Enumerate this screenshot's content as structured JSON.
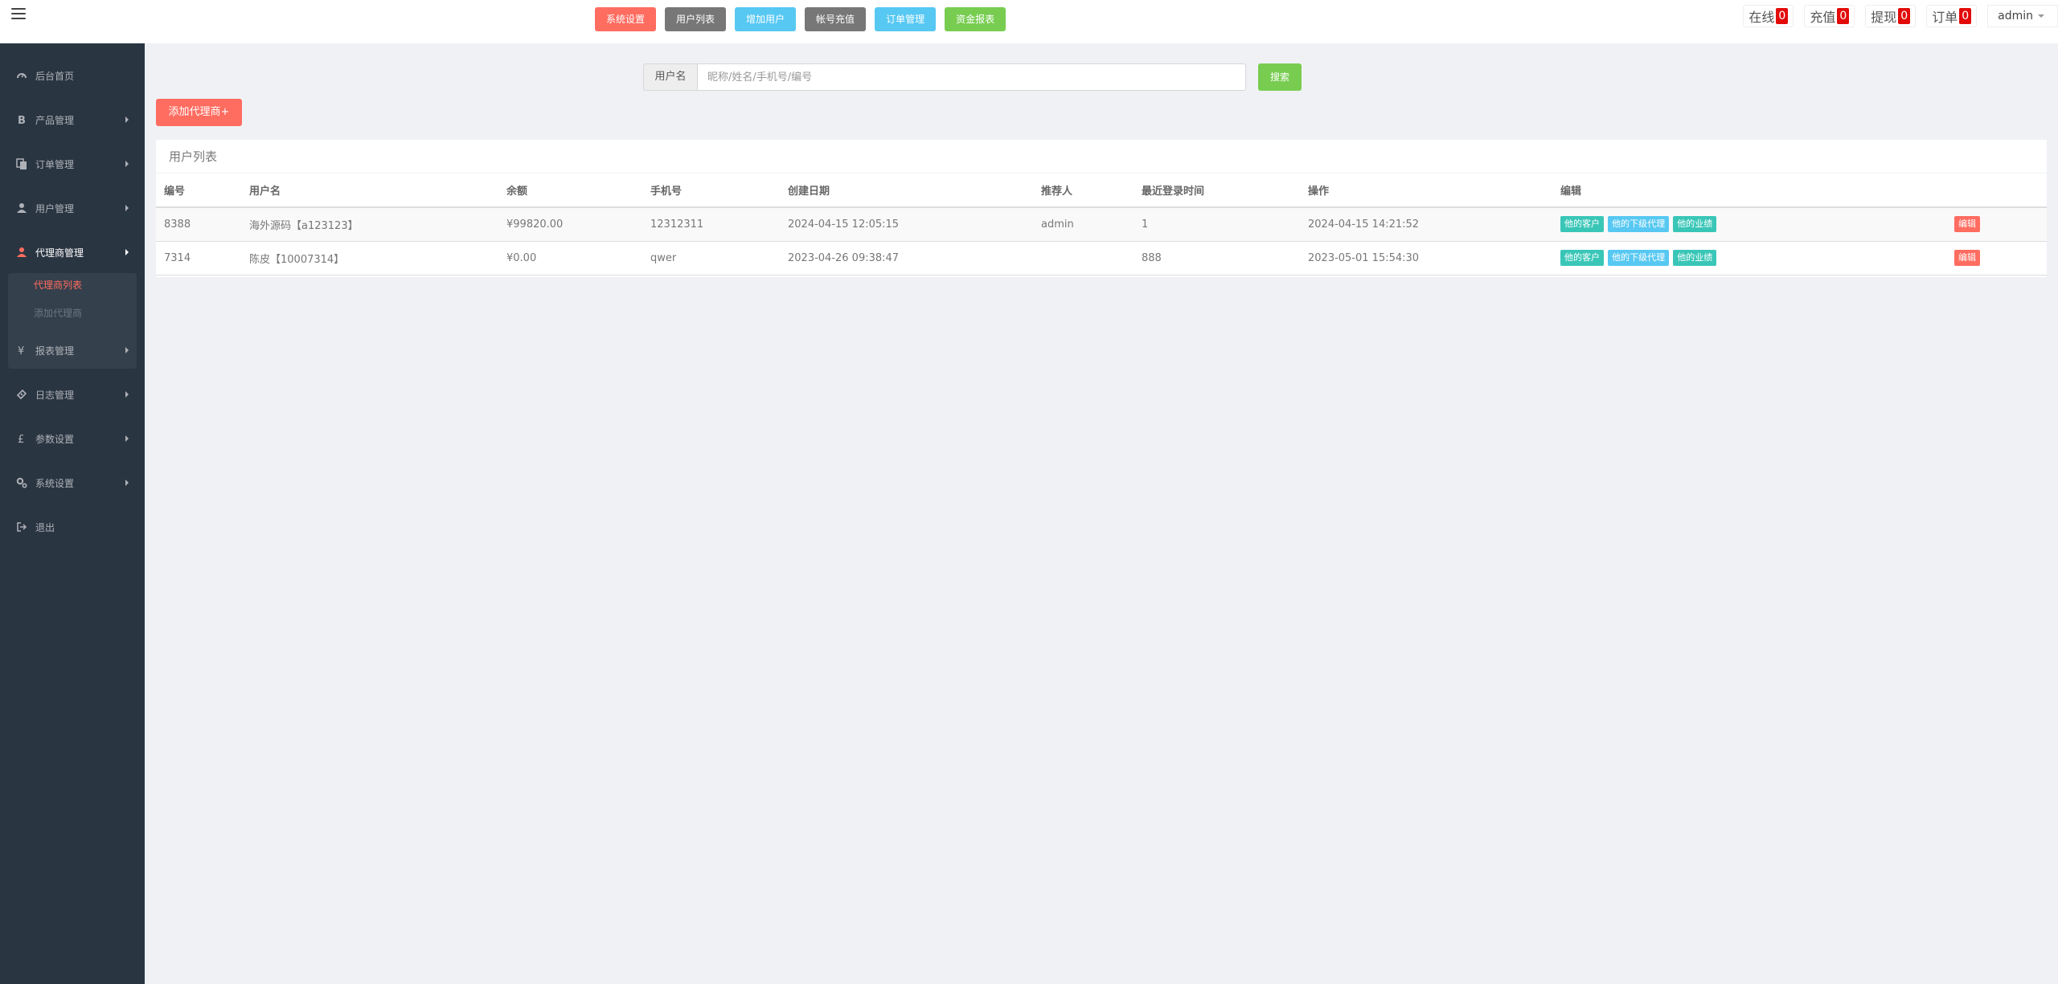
{
  "colors": {
    "sidebar_bg": "#2a3542",
    "accent_red": "#ff6c60",
    "success_green": "#78cd51",
    "info_blue": "#57c8f2",
    "gray": "#777777",
    "badge_red": "#e30a0a"
  },
  "header": {
    "menu_icon": "hamburger-icon",
    "quick_nav": [
      {
        "label": "系统设置",
        "color": "#ff6c60"
      },
      {
        "label": "用户列表",
        "color": "#777777"
      },
      {
        "label": "增加用户",
        "color": "#57c8f2"
      },
      {
        "label": "帐号充值",
        "color": "#777777"
      },
      {
        "label": "订单管理",
        "color": "#57c8f2"
      },
      {
        "label": "资金报表",
        "color": "#78cd51"
      }
    ],
    "stats": [
      {
        "label": "在线",
        "count": "0"
      },
      {
        "label": "充值",
        "count": "0"
      },
      {
        "label": "提现",
        "count": "0"
      },
      {
        "label": "订单",
        "count": "0"
      }
    ],
    "username": "admin"
  },
  "sidebar": {
    "items": [
      {
        "label": "后台首页",
        "icon": "dashboard-icon"
      },
      {
        "label": "产品管理",
        "icon": "bitcoin-icon"
      },
      {
        "label": "订单管理",
        "icon": "copy-icon"
      },
      {
        "label": "用户管理",
        "icon": "user-icon"
      },
      {
        "label": "代理商管理",
        "icon": "sitemap-icon",
        "active": true
      },
      {
        "label": "报表管理",
        "icon": "yen-icon"
      },
      {
        "label": "日志管理",
        "icon": "ticket-icon"
      },
      {
        "label": "参数设置",
        "icon": "pound-icon"
      },
      {
        "label": "系统设置",
        "icon": "cogs-icon"
      },
      {
        "label": "退出",
        "icon": "sign-out-icon"
      }
    ],
    "sub_items": [
      {
        "label": "代理商列表",
        "current": true
      },
      {
        "label": "添加代理商",
        "current": false
      }
    ]
  },
  "search": {
    "addon_label": "用户名",
    "placeholder": "昵称/姓名/手机号/编号",
    "value": "",
    "button_label": "搜索"
  },
  "add_agent_button": "添加代理商+",
  "panel": {
    "title": "用户列表",
    "columns": [
      "编号",
      "用户名",
      "余额",
      "手机号",
      "创建日期",
      "推荐人",
      "最近登录时间",
      "操作",
      "编辑"
    ],
    "rows": [
      {
        "id": "8388",
        "username": "海外源码【a123123】",
        "balance": "¥99820.00",
        "phone": "12312311",
        "created": "2024-04-15 12:05:15",
        "referrer": "admin",
        "recent_login": "1",
        "operation": "2024-04-15 14:21:52"
      },
      {
        "id": "7314",
        "username": "陈皮【10007314】",
        "balance": "¥0.00",
        "phone": "qwer",
        "created": "2023-04-26 09:38:47",
        "referrer": "",
        "recent_login": "888",
        "operation": "2023-05-01 15:54:30"
      }
    ],
    "actions": {
      "customers": "他的客户",
      "sub_agents": "他的下级代理",
      "performance": "他的业绩",
      "edit": "编辑"
    }
  }
}
